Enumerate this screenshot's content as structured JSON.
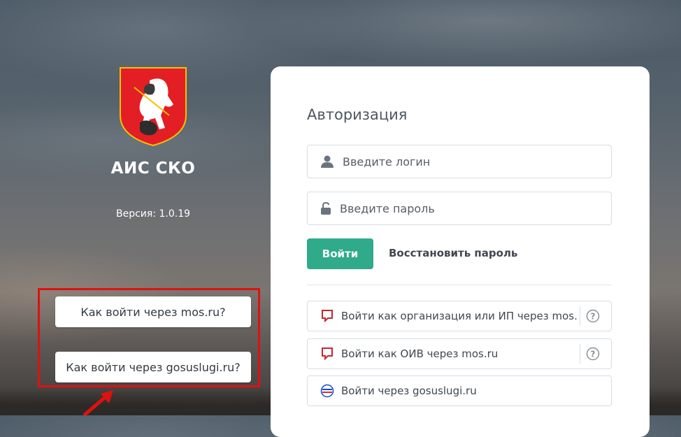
{
  "app": {
    "title": "АИС СКО",
    "version": "Версия: 1.0.19"
  },
  "help": {
    "mos_label": "Как войти через mos.ru?",
    "gosuslugi_label": "Как войти через gosuslugi.ru?"
  },
  "auth": {
    "title": "Авторизация",
    "login_placeholder": "Введите логин",
    "password_placeholder": "Введите пароль",
    "login_button": "Войти",
    "restore_link": "Восстановить пароль",
    "alt_org": "Войти как организация или ИП через mos.ru",
    "alt_oiv": "Войти как ОИВ через mos.ru",
    "alt_gosuslugi": "Войти через gosuslugi.ru"
  },
  "colors": {
    "accent": "#2faa8a",
    "highlight_box": "#e01010",
    "mos_icon": "#c8262c"
  }
}
